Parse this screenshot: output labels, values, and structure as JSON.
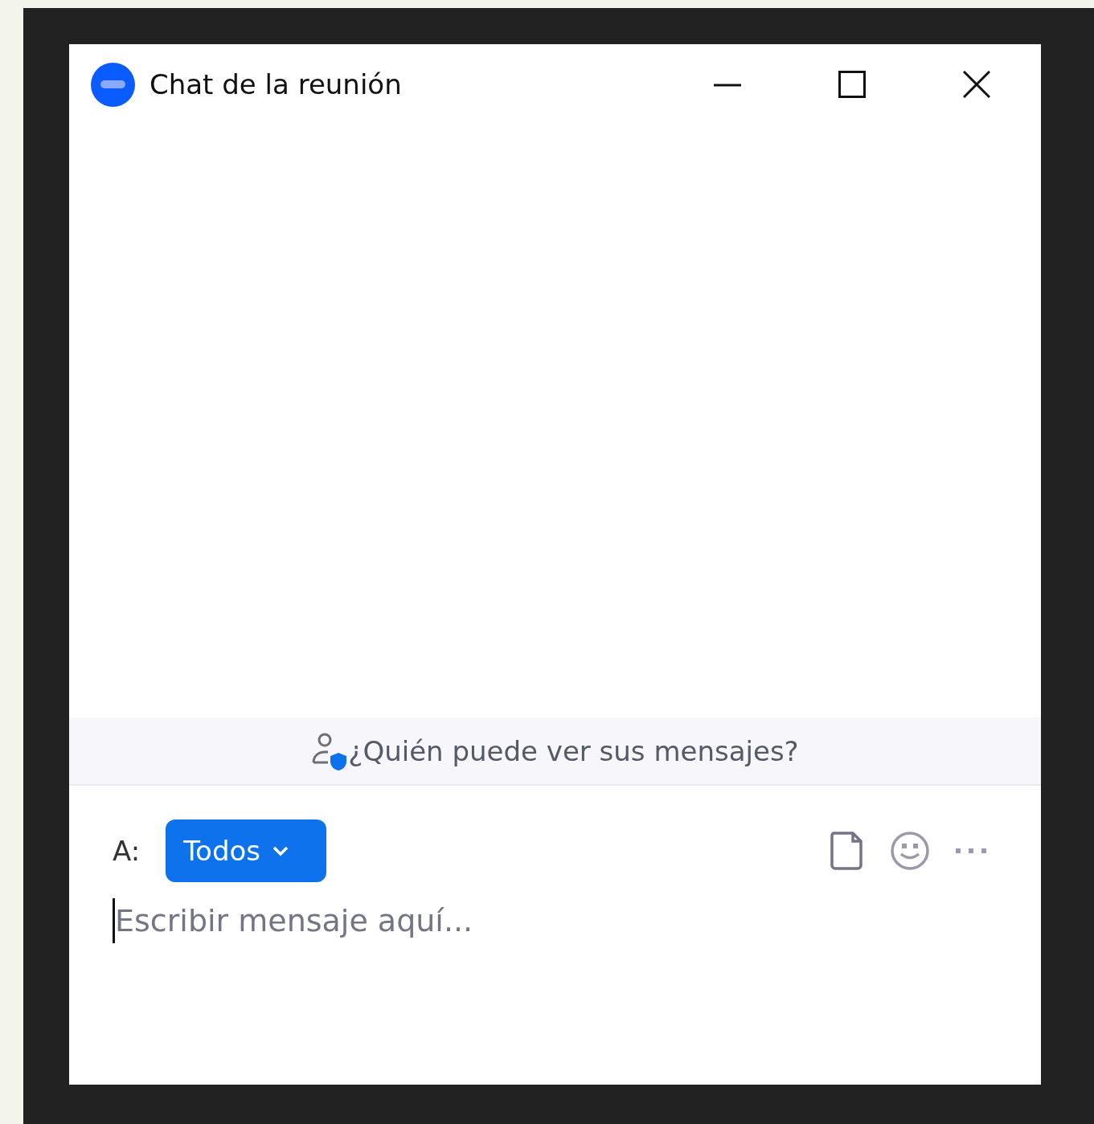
{
  "window": {
    "title": "Chat de la reunión"
  },
  "privacy_notice": {
    "text": "¿Quién puede ver sus mensajes?"
  },
  "composer": {
    "to_label": "A:",
    "recipient": "Todos",
    "placeholder": "Escribir mensaje aquí..."
  }
}
